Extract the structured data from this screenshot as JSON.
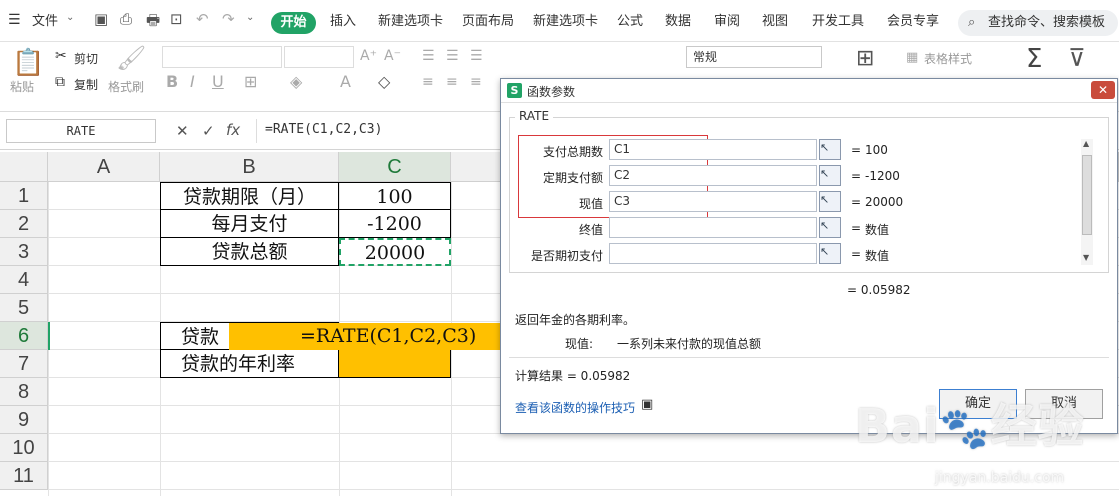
{
  "menu": {
    "file": "文件",
    "tabs": [
      "开始",
      "插入",
      "新建选项卡",
      "页面布局",
      "新建选项卡",
      "公式",
      "数据",
      "审阅",
      "视图",
      "开发工具",
      "会员专享"
    ],
    "search": "查找命令、搜索模板"
  },
  "ribbon": {
    "cut": "剪切",
    "paste": "粘贴",
    "copy": "复制",
    "format_painter": "格式刷",
    "number_format": "常规",
    "table_style": "表格样式"
  },
  "formula_bar": {
    "name_box": "RATE",
    "fx": "fx",
    "formula": "=RATE(C1,C2,C3)"
  },
  "grid": {
    "columns": [
      "A",
      "B",
      "C"
    ],
    "rows": [
      "1",
      "2",
      "3",
      "4",
      "5",
      "6",
      "7",
      "8",
      "9",
      "10",
      "11"
    ],
    "cells": {
      "B1": "贷款期限（月）",
      "C1": "100",
      "B2": "每月支付",
      "C2": "-1200",
      "B3": "贷款总额",
      "C3": "20000",
      "B6": "贷款",
      "C6": "=RATE(C1,C2,C3)",
      "B7": "贷款的年利率"
    },
    "highlight_color": "#ffc000"
  },
  "dialog": {
    "title": "函数参数",
    "function_name": "RATE",
    "args": [
      {
        "label": "支付总期数",
        "value": "C1",
        "result": "100"
      },
      {
        "label": "定期支付额",
        "value": "C2",
        "result": "-1200"
      },
      {
        "label": "现值",
        "value": "C3",
        "result": "20000"
      },
      {
        "label": "终值",
        "value": "",
        "result": "数值"
      },
      {
        "label": "是否期初支付",
        "value": "",
        "result": "数值"
      }
    ],
    "eq": "=",
    "overall_result": "= 0.05982",
    "description": "返回年金的各期利率。",
    "param_help_name": "现值:",
    "param_help_text": "一系列未来付款的现值总额",
    "calc_result": "计算结果 = 0.05982",
    "help_link": "查看该函数的操作技巧",
    "ok": "确定",
    "cancel": "取消"
  },
  "watermark": {
    "logo": "Bai",
    "brand": "经验",
    "url": "jingyan.baidu.com"
  }
}
